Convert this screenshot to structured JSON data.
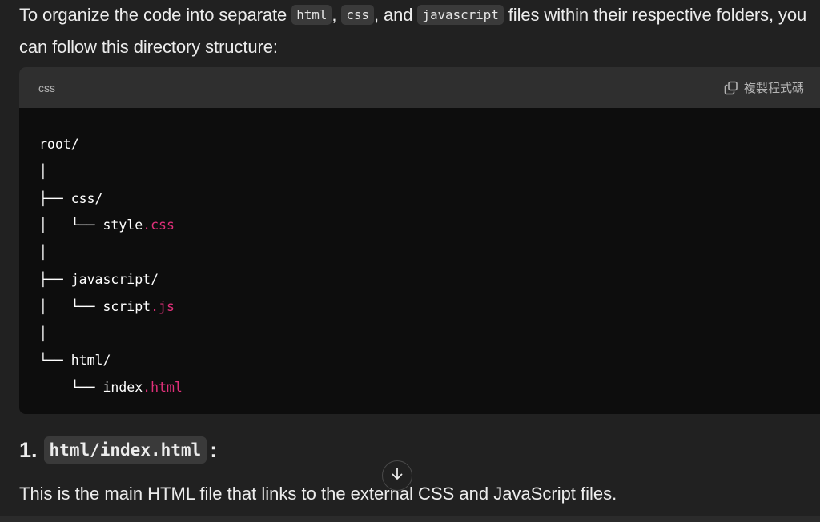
{
  "intro": {
    "part1": "To organize the code into separate ",
    "code1": "html",
    "part2": ", ",
    "code2": "css",
    "part3": ", and ",
    "code3": "javascript",
    "part4": " files within their respective folders, you can follow this directory structure:"
  },
  "code_block": {
    "language": "css",
    "copy_label": "複製程式碼",
    "lines": {
      "l1": "root/",
      "l2": "│",
      "l3": "├── css/",
      "l4_prefix": "│   └── style",
      "l4_ext": ".css",
      "l5": "│",
      "l6": "├── javascript/",
      "l7_prefix": "│   └── script",
      "l7_ext": ".js",
      "l8": "│",
      "l9": "└── html/",
      "l10_prefix": "    └── index",
      "l10_ext": ".html"
    }
  },
  "section": {
    "number": "1.",
    "code": "html/index.html",
    "colon": ":"
  },
  "paragraph": "This is the main HTML file that links to the external CSS and JavaScript files.",
  "icons": {
    "copy": "copy-icon",
    "scroll": "arrow-down-icon"
  },
  "colors": {
    "background": "#212121",
    "code_bg": "#0d0d0d",
    "code_header_bg": "#2f2f2f",
    "extension": "#df3079"
  }
}
